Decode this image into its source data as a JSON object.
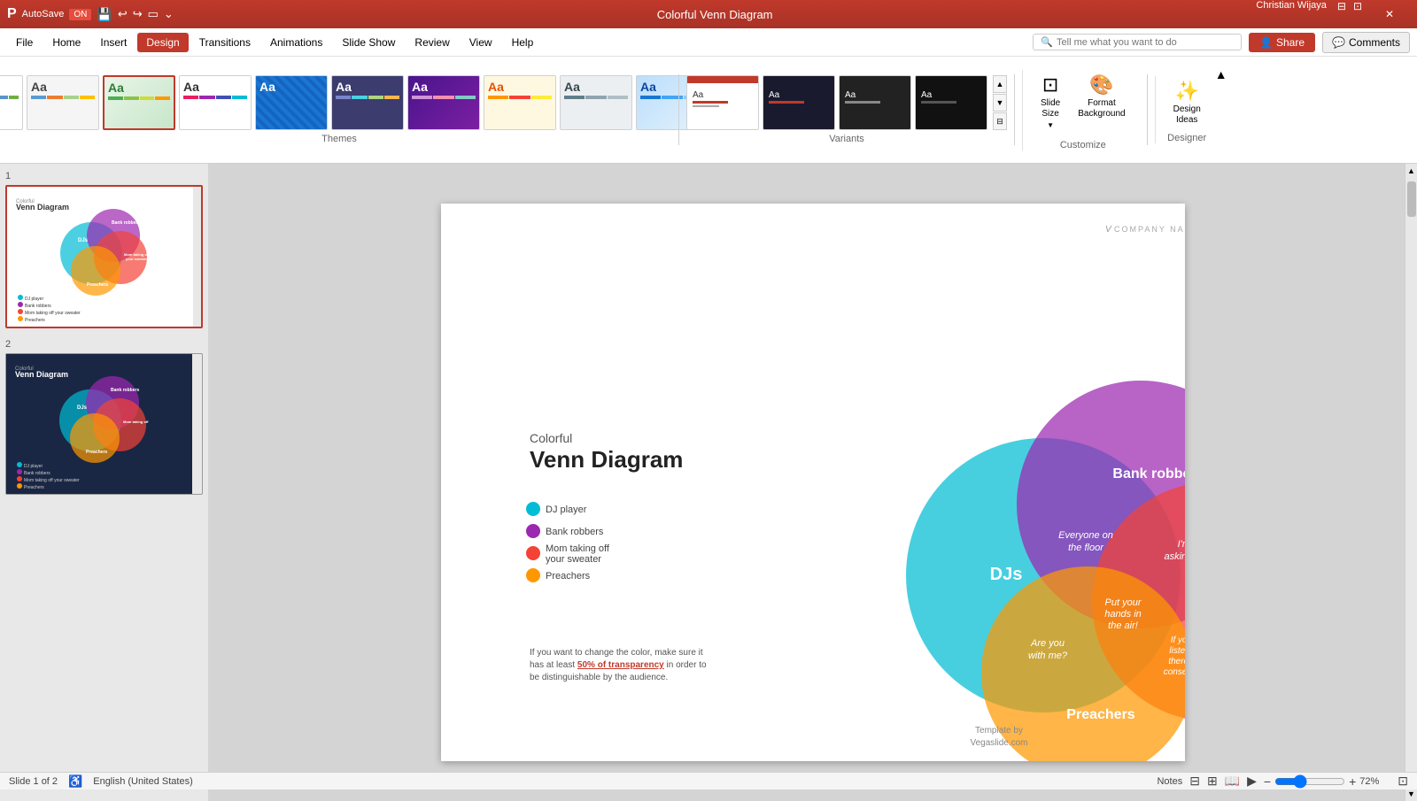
{
  "titlebar": {
    "autosave": "AutoSave",
    "autosave_on": "ON",
    "title": "Colorful Venn Diagram",
    "user": "Christian Wijaya",
    "minimize": "🗕",
    "restore": "🗗",
    "close": "✕"
  },
  "menubar": {
    "items": [
      "File",
      "Home",
      "Insert",
      "Design",
      "Transitions",
      "Animations",
      "Slide Show",
      "Review",
      "View",
      "Help"
    ],
    "active": "Design",
    "search_placeholder": "Tell me what you want to do",
    "share": "Share",
    "comments": "Comments"
  },
  "ribbon": {
    "themes_label": "Themes",
    "variants_label": "Variants",
    "customize_label": "Customize",
    "designer_label": "Designer",
    "slide_size": "Slide\nSize",
    "format_background": "Format\nBackground",
    "design_ideas": "Design\nIdeas",
    "themes": [
      {
        "label": "Aa",
        "type": "default"
      },
      {
        "label": "Aa",
        "type": "theme2"
      },
      {
        "label": "Aa",
        "type": "theme3"
      },
      {
        "label": "Aa",
        "type": "theme4"
      },
      {
        "label": "Aa",
        "type": "theme5"
      },
      {
        "label": "Aa",
        "type": "theme6"
      },
      {
        "label": "Aa",
        "type": "theme7"
      },
      {
        "label": "Aa",
        "type": "theme8"
      },
      {
        "label": "Aa",
        "type": "theme9"
      },
      {
        "label": "Aa",
        "type": "theme10"
      }
    ],
    "variants": [
      {
        "type": "v1"
      },
      {
        "type": "v2"
      },
      {
        "type": "v3"
      },
      {
        "type": "v4"
      }
    ]
  },
  "slides": [
    {
      "num": "1",
      "active": true,
      "bg": "white"
    },
    {
      "num": "2",
      "active": false,
      "bg": "#1a2744"
    }
  ],
  "slide": {
    "company": "COMPANY NAME",
    "title_small": "Colorful",
    "title_big": "Venn Diagram",
    "circles": [
      {
        "id": "dj",
        "label": "DJs",
        "color": "#00bcd4"
      },
      {
        "id": "bank",
        "label": "Bank robbers",
        "color": "#9c27b0"
      },
      {
        "id": "mom",
        "label": "Mom taking off your sweater",
        "color": "#f44336"
      },
      {
        "id": "preach",
        "label": "Preachers",
        "color": "#ff9800"
      }
    ],
    "legend": [
      {
        "color": "#00bcd4",
        "label": "DJ player"
      },
      {
        "color": "#9c27b0",
        "label": "Bank robbers"
      },
      {
        "color": "#f44336",
        "label": "Mom taking off your sweater"
      },
      {
        "color": "#ff9800",
        "label": "Preachers"
      }
    ],
    "intersections": [
      {
        "label": "Everyone on the floor"
      },
      {
        "label": "I'm not asking twice!"
      },
      {
        "label": "Put your hands in the air!"
      },
      {
        "label": "Are you with me?"
      },
      {
        "label": "If you don't listen to me there will be consequences"
      }
    ],
    "note": "If you want to change the color, make sure it has at least 50% of transparency in order to be distinguishable by the audience.",
    "template_by": "Template by\nVegaslide.com"
  },
  "statusbar": {
    "slide_info": "Slide 1 of 2",
    "language": "English (United States)",
    "notes": "Notes",
    "zoom": "72%"
  }
}
